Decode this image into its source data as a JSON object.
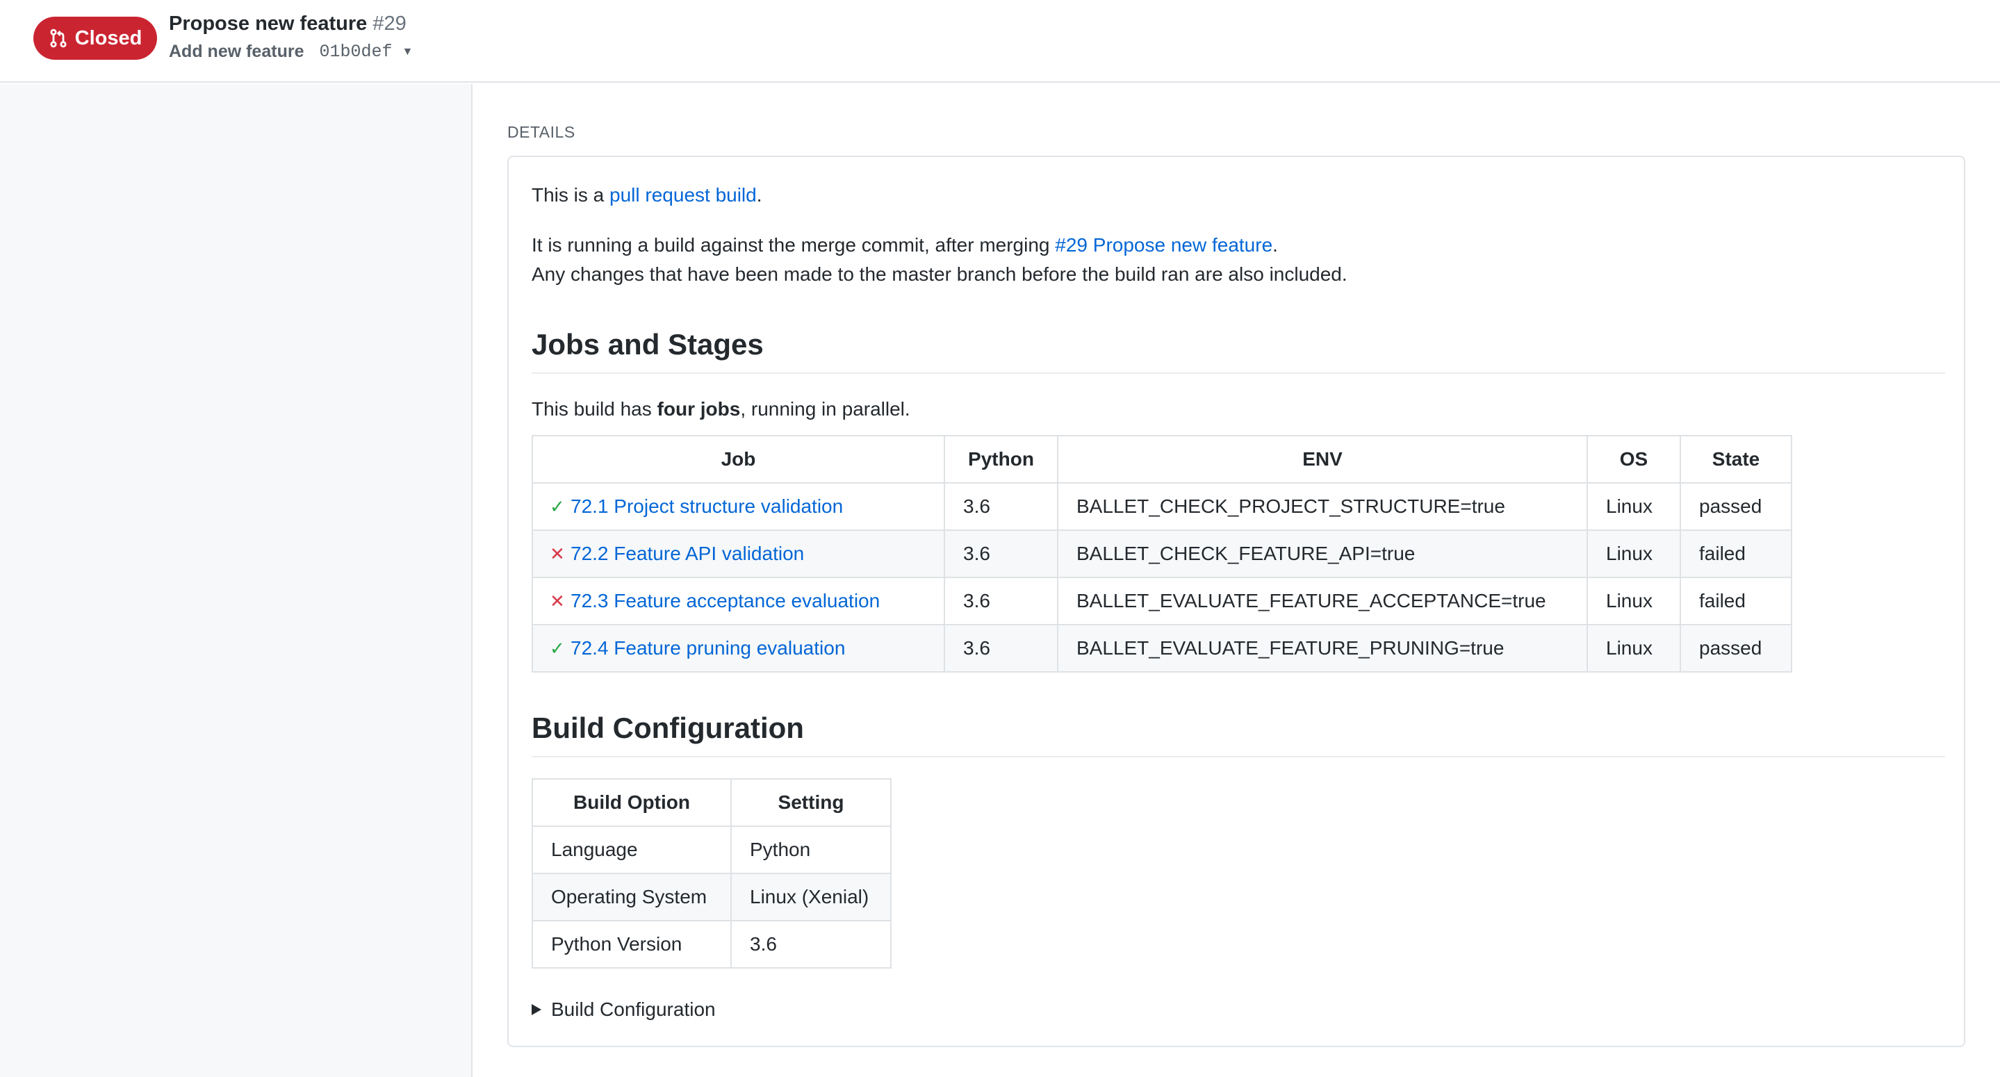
{
  "header": {
    "state_label": "Closed",
    "title": "Propose new feature",
    "number": "#29",
    "branch": "Add new feature",
    "sha": "01b0def"
  },
  "details": {
    "section_label": "DETAILS",
    "intro_prefix": "This is a ",
    "intro_link": "pull request build",
    "intro_suffix": ".",
    "merge_prefix": "It is running a build against the merge commit, after merging ",
    "merge_link": "#29 Propose new feature",
    "merge_suffix": ".",
    "changes_note": "Any changes that have been made to the master branch before the build ran are also included.",
    "jobs_heading": "Jobs and Stages",
    "jobs_intro_prefix": "This build has ",
    "jobs_intro_bold": "four jobs",
    "jobs_intro_suffix": ", running in parallel.",
    "jobs_table": {
      "headers": [
        "Job",
        "Python",
        "ENV",
        "OS",
        "State"
      ],
      "rows": [
        {
          "status_icon": "check-icon",
          "status_glyph": "✓",
          "job": "72.1 Project structure validation",
          "python": "3.6",
          "env": "BALLET_CHECK_PROJECT_STRUCTURE=true",
          "os": "Linux",
          "state": "passed"
        },
        {
          "status_icon": "x-icon",
          "status_glyph": "✕",
          "job": "72.2 Feature API validation",
          "python": "3.6",
          "env": "BALLET_CHECK_FEATURE_API=true",
          "os": "Linux",
          "state": "failed"
        },
        {
          "status_icon": "x-icon",
          "status_glyph": "✕",
          "job": "72.3 Feature acceptance evaluation",
          "python": "3.6",
          "env": "BALLET_EVALUATE_FEATURE_ACCEPTANCE=true",
          "os": "Linux",
          "state": "failed"
        },
        {
          "status_icon": "check-icon",
          "status_glyph": "✓",
          "job": "72.4 Feature pruning evaluation",
          "python": "3.6",
          "env": "BALLET_EVALUATE_FEATURE_PRUNING=true",
          "os": "Linux",
          "state": "passed"
        }
      ]
    },
    "config_heading": "Build Configuration",
    "config_table": {
      "headers": [
        "Build Option",
        "Setting"
      ],
      "rows": [
        {
          "option": "Language",
          "setting": "Python"
        },
        {
          "option": "Operating System",
          "setting": "Linux (Xenial)"
        },
        {
          "option": "Python Version",
          "setting": "3.6"
        }
      ]
    },
    "config_toggle_label": "Build Configuration"
  },
  "colors": {
    "closed_badge": "#cb2431",
    "link": "#0366d6",
    "pass": "#28a745",
    "fail": "#d73a49"
  }
}
